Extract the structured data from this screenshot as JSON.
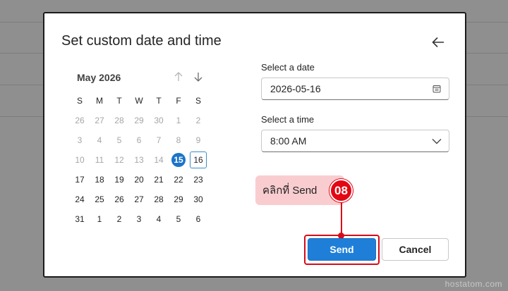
{
  "dialog": {
    "title": "Set custom date and time"
  },
  "calendar": {
    "month_label": "May 2026",
    "weekdays": [
      "S",
      "M",
      "T",
      "W",
      "T",
      "F",
      "S"
    ],
    "weeks": [
      [
        {
          "d": "26",
          "m": true
        },
        {
          "d": "27",
          "m": true
        },
        {
          "d": "28",
          "m": true
        },
        {
          "d": "29",
          "m": true
        },
        {
          "d": "30",
          "m": true
        },
        {
          "d": "1",
          "m": true
        },
        {
          "d": "2",
          "m": true
        }
      ],
      [
        {
          "d": "3",
          "m": true
        },
        {
          "d": "4",
          "m": true
        },
        {
          "d": "5",
          "m": true
        },
        {
          "d": "6",
          "m": true
        },
        {
          "d": "7",
          "m": true
        },
        {
          "d": "8",
          "m": true
        },
        {
          "d": "9",
          "m": true
        }
      ],
      [
        {
          "d": "10",
          "m": true
        },
        {
          "d": "11",
          "m": true
        },
        {
          "d": "12",
          "m": true
        },
        {
          "d": "13",
          "m": true
        },
        {
          "d": "14",
          "m": true
        },
        {
          "d": "15",
          "today": true
        },
        {
          "d": "16",
          "selected": true
        }
      ],
      [
        {
          "d": "17"
        },
        {
          "d": "18"
        },
        {
          "d": "19"
        },
        {
          "d": "20"
        },
        {
          "d": "21"
        },
        {
          "d": "22"
        },
        {
          "d": "23"
        }
      ],
      [
        {
          "d": "24"
        },
        {
          "d": "25"
        },
        {
          "d": "26"
        },
        {
          "d": "27"
        },
        {
          "d": "28"
        },
        {
          "d": "29"
        },
        {
          "d": "30"
        }
      ],
      [
        {
          "d": "31"
        },
        {
          "d": "1"
        },
        {
          "d": "2"
        },
        {
          "d": "3"
        },
        {
          "d": "4"
        },
        {
          "d": "5"
        },
        {
          "d": "6"
        }
      ]
    ]
  },
  "date_field": {
    "label": "Select a date",
    "value": "2026-05-16",
    "icon": "calendar-icon"
  },
  "time_field": {
    "label": "Select a time",
    "value": "8:00 AM",
    "icon": "chevron-down-icon"
  },
  "annotation": {
    "text": "คลิกที่ Send",
    "step": "08",
    "color": "#e30613"
  },
  "buttons": {
    "send": "Send",
    "cancel": "Cancel"
  },
  "colors": {
    "accent": "#1f7fd8",
    "today": "#1a74c9"
  },
  "watermark": "hostatom.com"
}
